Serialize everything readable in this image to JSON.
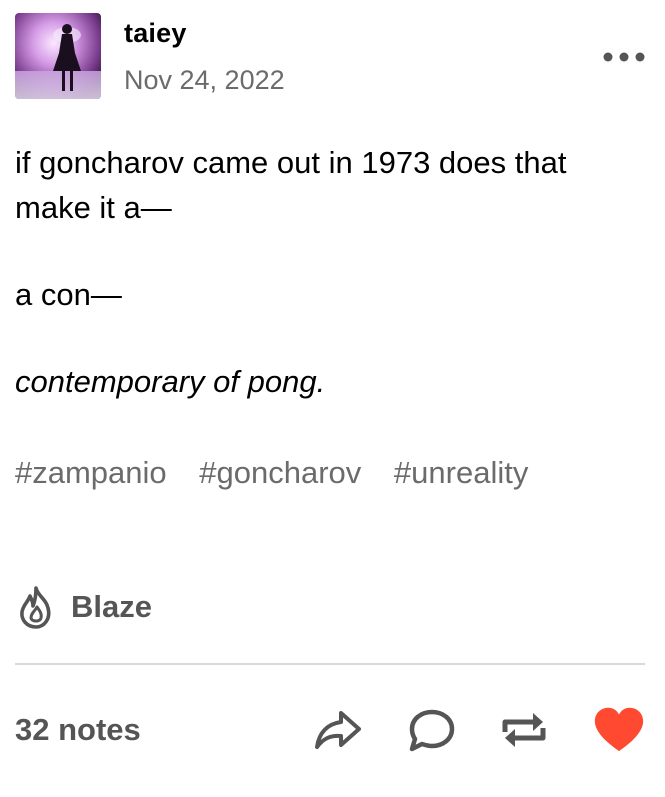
{
  "post": {
    "author": {
      "username": "taiey",
      "avatar_icon": "avatar-image"
    },
    "timestamp": "Nov 24, 2022",
    "menu_icon": "more-options-icon",
    "body": [
      {
        "text": "if goncharov came out in 1973 does that make it a—",
        "style": "normal"
      },
      {
        "text": "a con—",
        "style": "normal"
      },
      {
        "text": "contemporary of pong.",
        "style": "italic"
      }
    ],
    "tags": [
      "#zampanio",
      "#goncharov",
      "#unreality"
    ],
    "blaze": {
      "label": "Blaze",
      "icon": "flame-icon"
    },
    "footer": {
      "notes_label": "32 notes",
      "actions": [
        {
          "name": "share",
          "icon": "share-icon"
        },
        {
          "name": "reply",
          "icon": "comment-icon"
        },
        {
          "name": "reblog",
          "icon": "reblog-icon"
        },
        {
          "name": "like",
          "icon": "heart-icon",
          "liked": true
        }
      ]
    }
  },
  "colors": {
    "text": "#000000",
    "muted": "#6b6b6b",
    "icon": "#555555",
    "like": "#ff4930",
    "divider": "#d9d9d9"
  }
}
